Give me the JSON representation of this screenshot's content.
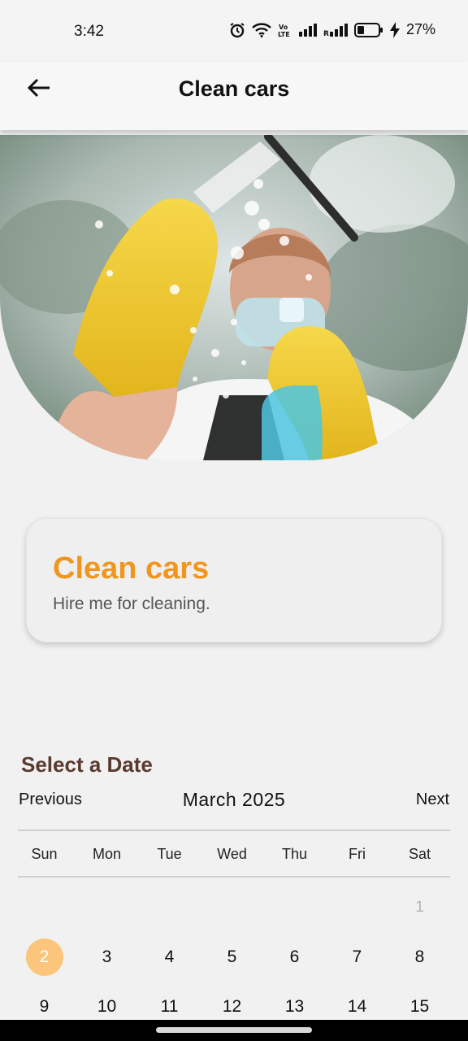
{
  "status": {
    "time": "3:42",
    "battery_text": "27%",
    "icons": [
      "alarm-icon",
      "wifi-icon",
      "volte-icon",
      "signal-icon",
      "signal-roaming-icon",
      "battery-icon",
      "charging-icon"
    ]
  },
  "appbar": {
    "title": "Clean cars",
    "back_icon": "arrow-left-icon"
  },
  "hero": {
    "image": "woman-cleaning-window-with-yellow-gloves"
  },
  "card": {
    "title": "Clean cars",
    "subtitle": "Hire me for cleaning."
  },
  "calendar": {
    "heading": "Select a Date",
    "prev_label": "Previous",
    "next_label": "Next",
    "month_label": "March 2025",
    "weekdays": [
      "Sun",
      "Mon",
      "Tue",
      "Wed",
      "Thu",
      "Fri",
      "Sat"
    ],
    "rows": [
      [
        "",
        "",
        "",
        "",
        "",
        "",
        "1"
      ],
      [
        "2",
        "3",
        "4",
        "5",
        "6",
        "7",
        "8"
      ],
      [
        "9",
        "10",
        "11",
        "12",
        "13",
        "14",
        "15"
      ]
    ],
    "selected_day": "2",
    "muted_day": "1"
  },
  "colors": {
    "accent": "#f0961e",
    "heading": "#5a3a2e",
    "selected": "#fbc67b"
  }
}
